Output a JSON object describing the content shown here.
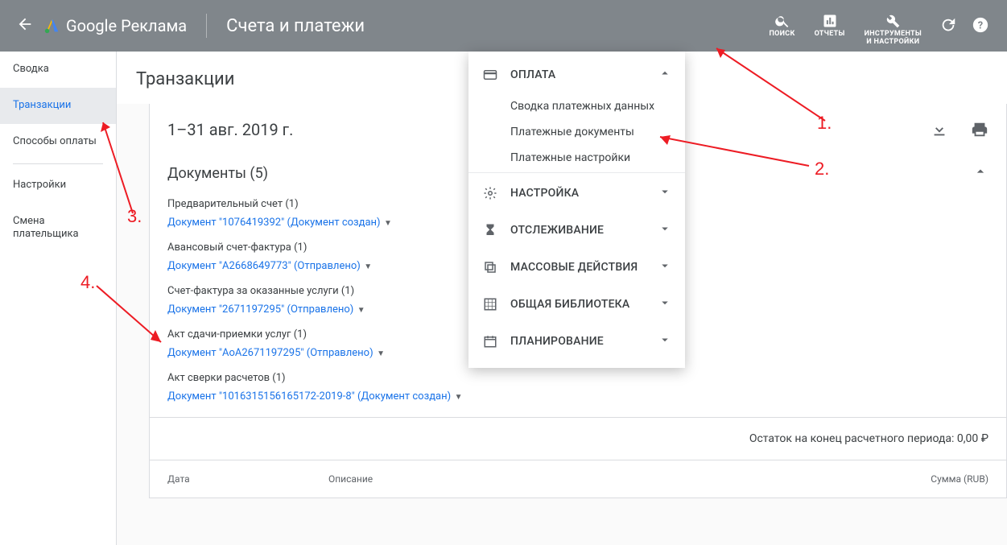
{
  "header": {
    "product": "Google Реклама",
    "title": "Счета и платежи",
    "tools": {
      "search": "ПОИСК",
      "reports": "ОТЧЕТЫ",
      "settings_line1": "ИНСТРУМЕНТЫ",
      "settings_line2": "И НАСТРОЙКИ"
    }
  },
  "sidebar": {
    "summary": "Сводка",
    "transactions": "Транзакции",
    "payment_methods": "Способы оплаты",
    "settings": "Настройки",
    "change_payer": "Смена плательщика"
  },
  "main": {
    "page_title": "Транзакции",
    "date_range": "1–31 авг. 2019 г.",
    "documents_header": "Документы (5)",
    "groups": [
      {
        "title": "Предварительный счет (1)",
        "link": "Документ \"1076419392\" (Документ создан)"
      },
      {
        "title": "Авансовый счет-фактура (1)",
        "link": "Документ \"A2668649773\" (Отправлено)"
      },
      {
        "title": "Счет-фактура за оказанные услуги (1)",
        "link": "Документ \"2671197295\" (Отправлено)"
      },
      {
        "title": "Акт сдачи-приемки услуг (1)",
        "link": "Документ \"AoA2671197295\" (Отправлено)"
      },
      {
        "title": "Акт сверки расчетов (1)",
        "link": "Документ \"1016315156165172-2019-8\" (Документ создан)"
      }
    ],
    "balance": "Остаток на конец расчетного периода: 0,00 ₽",
    "table": {
      "date": "Дата",
      "desc": "Описание",
      "sum": "Сумма (RUB)"
    }
  },
  "menu": {
    "sections": [
      {
        "icon": "card",
        "label": "ОПЛАТА",
        "open": true,
        "items": [
          "Сводка платежных данных",
          "Платежные документы",
          "Платежные настройки"
        ]
      },
      {
        "icon": "gear",
        "label": "НАСТРОЙКА",
        "open": false
      },
      {
        "icon": "hourglass",
        "label": "ОТСЛЕЖИВАНИЕ",
        "open": false
      },
      {
        "icon": "copy",
        "label": "МАССОВЫЕ ДЕЙСТВИЯ",
        "open": false
      },
      {
        "icon": "grid",
        "label": "ОБЩАЯ БИБЛИОТЕКА",
        "open": false
      },
      {
        "icon": "calendar",
        "label": "ПЛАНИРОВАНИЕ",
        "open": false
      }
    ]
  },
  "annotations": {
    "n1": "1.",
    "n2": "2.",
    "n3": "3.",
    "n4": "4."
  }
}
